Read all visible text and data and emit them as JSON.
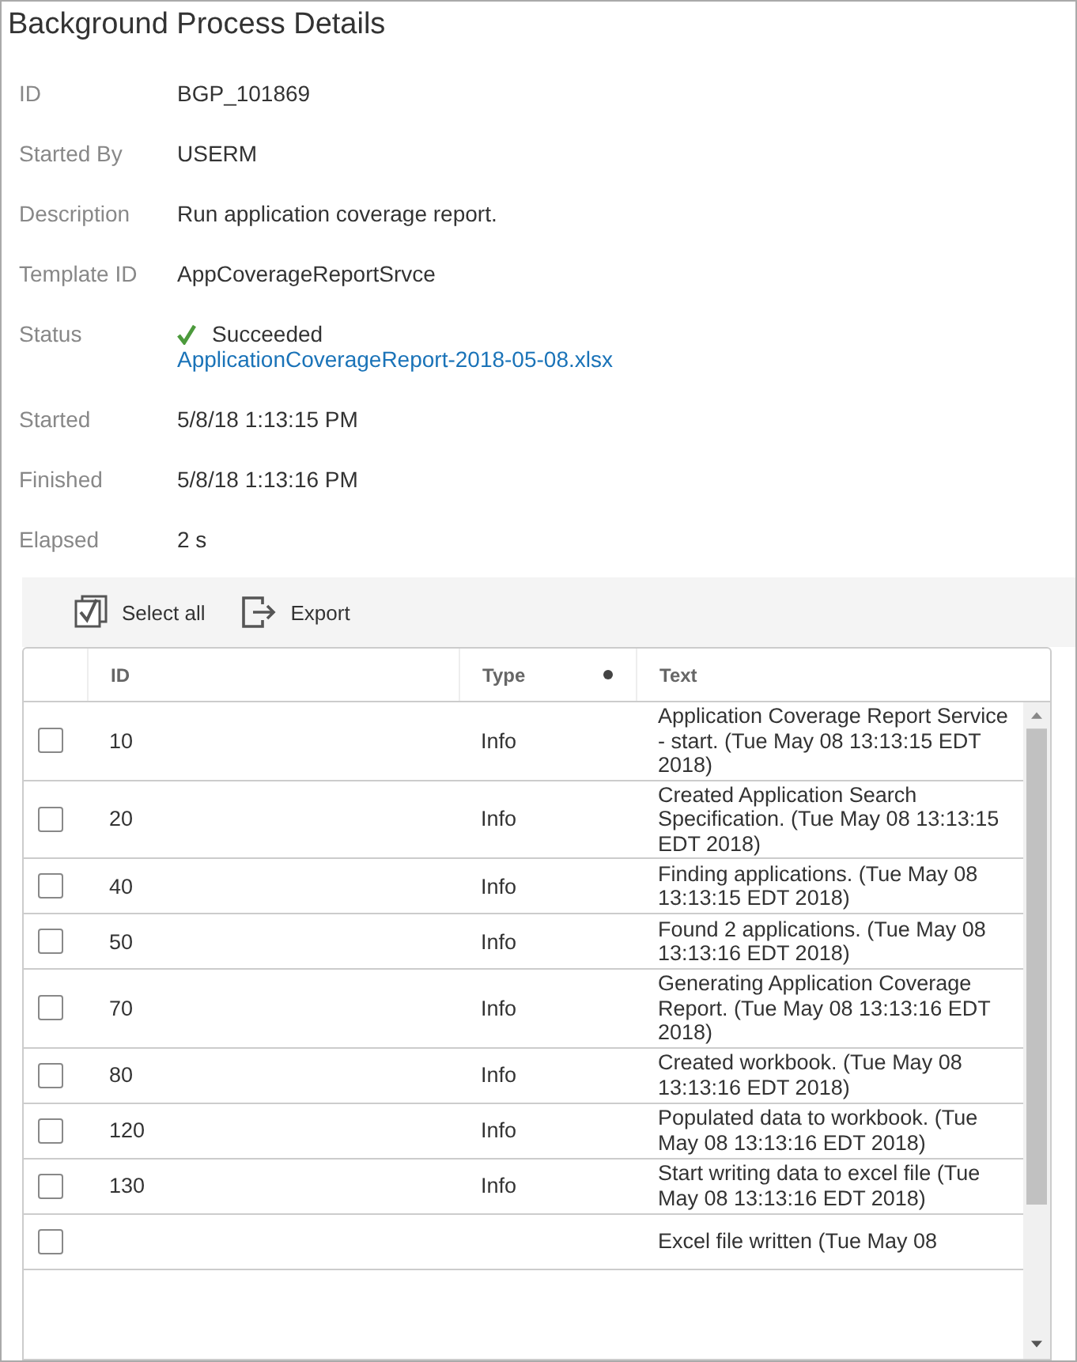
{
  "title": "Background Process Details",
  "fields": [
    {
      "label": "ID",
      "value": "BGP_101869"
    },
    {
      "label": "Started By",
      "value": "USERM"
    },
    {
      "label": "Description",
      "value": "Run application coverage report."
    },
    {
      "label": "Template ID",
      "value": "AppCoverageReportSrvce"
    },
    {
      "label": "Status",
      "kind": "status",
      "value": "Succeeded",
      "link": "ApplicationCoverageReport-2018-05-08.xlsx"
    },
    {
      "label": "Started",
      "value": "5/8/18 1:13:15 PM"
    },
    {
      "label": "Finished",
      "value": "5/8/18 1:13:16 PM"
    },
    {
      "label": "Elapsed",
      "value": "2 s"
    }
  ],
  "toolbar": [
    "Select all",
    "Export"
  ],
  "table": {
    "columns": [
      {
        "label": "ID",
        "sorted": false
      },
      {
        "label": "Type",
        "sorted": true
      },
      {
        "label": "Text",
        "sorted": false
      }
    ],
    "rows": [
      {
        "checked": false,
        "id": "10",
        "type": "Info",
        "text": "Application Coverage Report Service - start. (Tue May 08 13:13:15 EDT 2018)"
      },
      {
        "checked": false,
        "id": "20",
        "type": "Info",
        "text": "Created Application Search Specification. (Tue May 08 13:13:15 EDT 2018)"
      },
      {
        "checked": false,
        "id": "40",
        "type": "Info",
        "text": "Finding applications. (Tue May 08 13:13:15 EDT 2018)"
      },
      {
        "checked": false,
        "id": "50",
        "type": "Info",
        "text": "Found 2 applications. (Tue May 08 13:13:16 EDT 2018)"
      },
      {
        "checked": false,
        "id": "70",
        "type": "Info",
        "text": "Generating Application Coverage Report. (Tue May 08 13:13:16 EDT 2018)"
      },
      {
        "checked": false,
        "id": "80",
        "type": "Info",
        "text": "Created workbook. (Tue May 08 13:13:16 EDT 2018)"
      },
      {
        "checked": false,
        "id": "120",
        "type": "Info",
        "text": "Populated data to workbook. (Tue May 08 13:13:16 EDT 2018)"
      },
      {
        "checked": false,
        "id": "130",
        "type": "Info",
        "text": "Start writing data to excel file (Tue May 08 13:13:16 EDT 2018)"
      },
      {
        "checked": false,
        "id": "",
        "type": "",
        "text": "Excel file written (Tue May 08"
      }
    ]
  }
}
